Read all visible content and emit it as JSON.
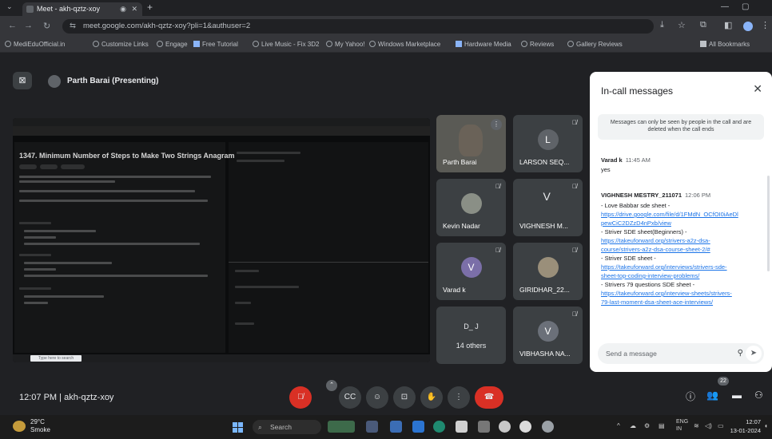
{
  "browser": {
    "tab_title": "Meet - akh-qztz-xoy",
    "url": "meet.google.com/akh-qztz-xoy?pli=1&authuser=2",
    "bookmarks": [
      "MediEduOfficial.in",
      "Customize Links",
      "Engage",
      "Free Tutorial",
      "Live Music - Fix 3D2",
      "My Yahoo!",
      "Windows Marketplace",
      "Hardware Media",
      "Reviews",
      "Gallery Reviews",
      "All Bookmarks"
    ]
  },
  "meet": {
    "presenter_label": "Parth Barai (Presenting)",
    "meeting_time": "12:07 PM",
    "separator": "|",
    "meeting_code": "akh-qztz-xoy",
    "participant_count": "22"
  },
  "shared_screen": {
    "problem_title": "1347. Minimum Number of Steps to Make Two Strings Anagram",
    "taskbar_search": "Type here to search"
  },
  "tiles": [
    {
      "name": "Parth Barai",
      "kind": "camera"
    },
    {
      "name": "LARSON SEQ...",
      "kind": "avatar",
      "letter": "L",
      "color": "#5f6368"
    },
    {
      "name": "Kevin Nadar",
      "kind": "photo"
    },
    {
      "name": "VIGHNESH M...",
      "kind": "letter",
      "letter": "V"
    },
    {
      "name": "Varad k",
      "kind": "avatar",
      "letter": "V",
      "color": "#7b6fa8"
    },
    {
      "name": "GIRIDHAR_22...",
      "kind": "photo"
    },
    {
      "name": "14 others",
      "kind": "others",
      "initials": "D_ J"
    },
    {
      "name": "VIBHASHA NA...",
      "kind": "avatar",
      "letter": "V",
      "color": "#6b7079"
    }
  ],
  "chat": {
    "title": "In-call messages",
    "notice": "Messages can only be seen by people in the call and are deleted when the call ends",
    "messages": [
      {
        "sender": "Varad k",
        "time": "11:45 AM",
        "lines": [
          {
            "t": "yes",
            "link": false
          }
        ]
      },
      {
        "sender": "VIGHNESH MESTRY_211071",
        "time": "12:06 PM",
        "lines": [
          {
            "t": "- Love Babbar sde sheet -",
            "link": false
          },
          {
            "t": "https://drive.google.com/file/d/1FMdN_OCfOI0iAeDl",
            "link": true
          },
          {
            "t": "pewCiC2DZzD4nPxb/view",
            "link": true
          },
          {
            "t": "- Striver SDE sheet(Beginners) -",
            "link": false
          },
          {
            "t": "https://takeuforward.org/strivers-a2z-dsa-",
            "link": true
          },
          {
            "t": "course/strivers-a2z-dsa-course-sheet-2/#",
            "link": true
          },
          {
            "t": "- Striver SDE sheet -",
            "link": false
          },
          {
            "t": "https://takeuforward.org/interviews/strivers-sde-",
            "link": true
          },
          {
            "t": "sheet-top-coding-interview-problems/",
            "link": true
          },
          {
            "t": "- Strivers 79 questions SDE sheet -",
            "link": false
          },
          {
            "t": "https://takeuforward.org/interview-sheets/strivers-",
            "link": true
          },
          {
            "t": "79-last-moment-dsa-sheet-ace-interviews/",
            "link": true
          }
        ]
      }
    ],
    "input_placeholder": "Send a message"
  },
  "taskbar": {
    "temperature": "29°C",
    "weather_text": "Smoke",
    "search_label": "Search",
    "lang": "ENG",
    "lang2": "IN",
    "time": "12:07",
    "date": "13-01-2024"
  }
}
